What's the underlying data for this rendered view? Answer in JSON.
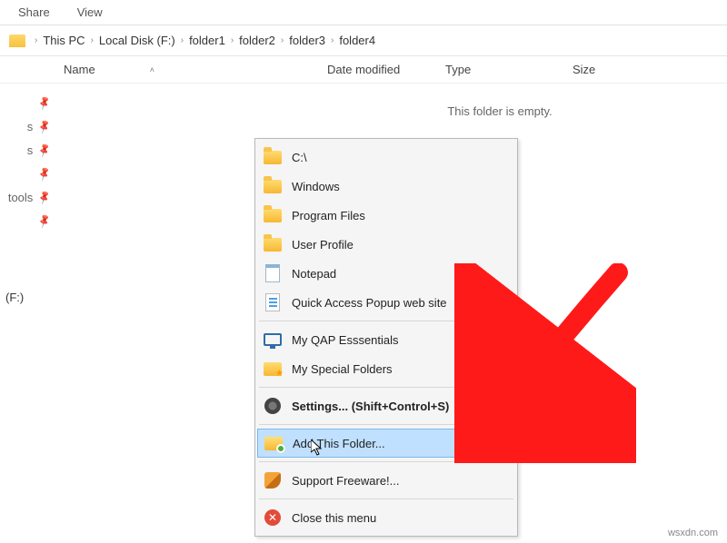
{
  "ribbon": {
    "share": "Share",
    "view": "View"
  },
  "breadcrumb": {
    "items": [
      "This PC",
      "Local Disk (F:)",
      "folder1",
      "folder2",
      "folder3",
      "folder4"
    ]
  },
  "columns": {
    "name": "Name",
    "date": "Date modified",
    "type": "Type",
    "size": "Size"
  },
  "leftnav": {
    "items": [
      "",
      "s",
      "s",
      "",
      "tools",
      ""
    ],
    "drive": "(F:)"
  },
  "empty_msg": "This folder is empty.",
  "menu": {
    "c_drive": "C:\\",
    "windows": "Windows",
    "program_files": "Program Files",
    "user_profile": "User Profile",
    "notepad": "Notepad",
    "qap_site": "Quick Access Popup web site",
    "essentials": "My QAP Esssentials",
    "special": "My Special Folders",
    "settings": "Settings... (Shift+Control+S)",
    "add_folder": "Add This Folder...",
    "support": "Support Freeware!...",
    "close": "Close this menu"
  },
  "watermark": "wsxdn.com"
}
